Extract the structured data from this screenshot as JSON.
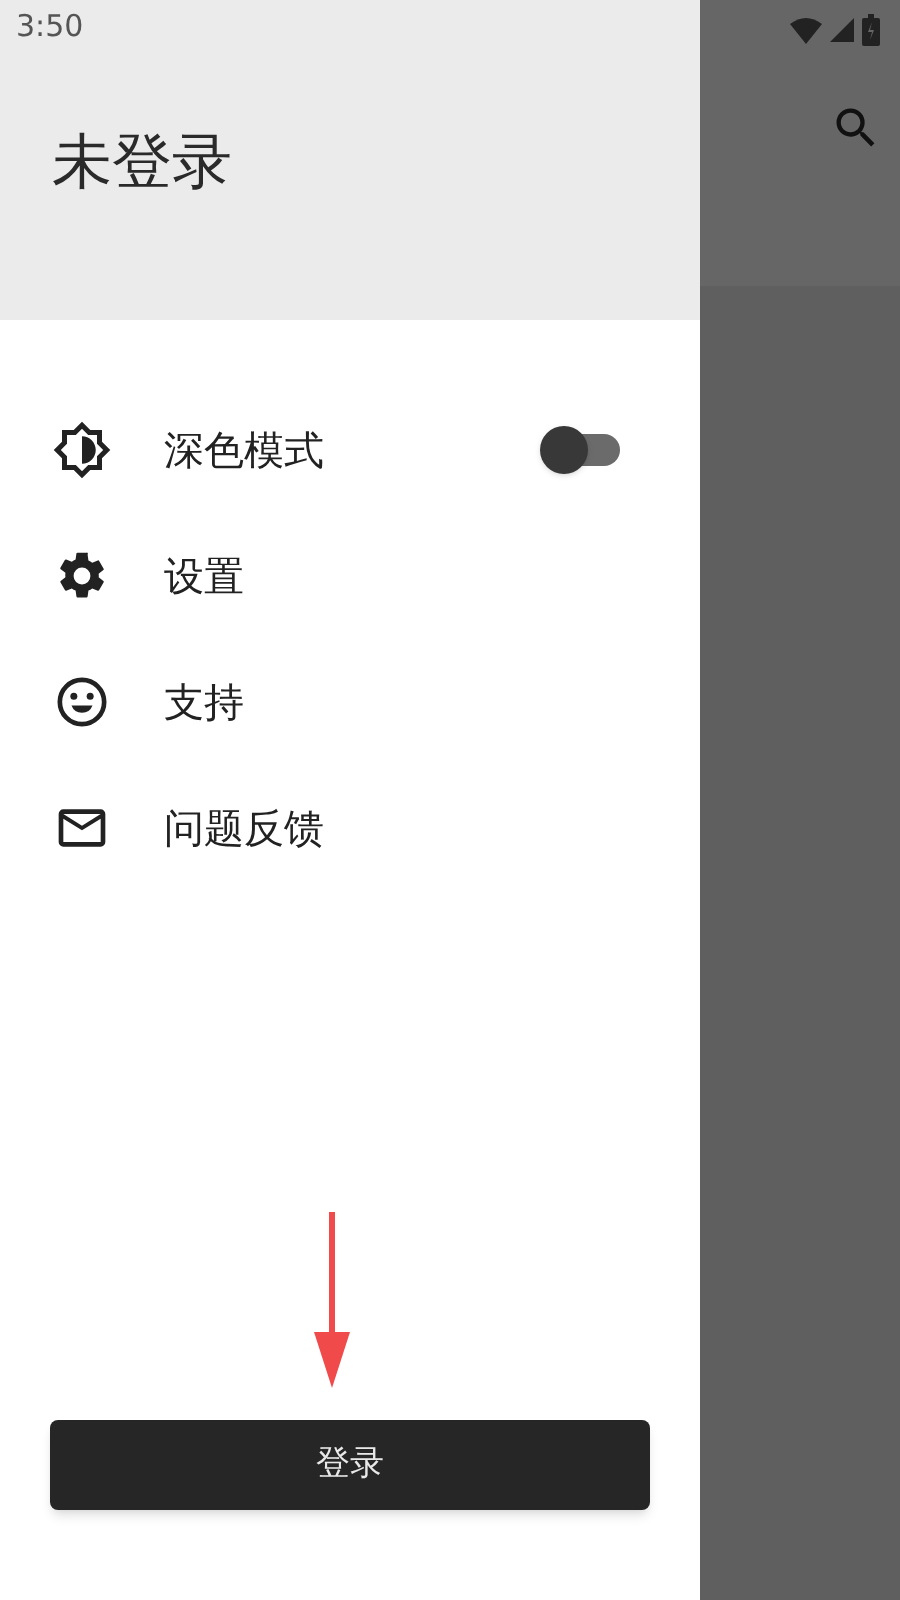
{
  "status_bar": {
    "time": "3:50"
  },
  "drawer": {
    "title": "未登录",
    "items": [
      {
        "kind": "toggle",
        "label": "深色模式",
        "on": false
      },
      {
        "kind": "link",
        "label": "设置"
      },
      {
        "kind": "link",
        "label": "支持"
      },
      {
        "kind": "link",
        "label": "问题反馈"
      }
    ],
    "login_button": "登录"
  }
}
